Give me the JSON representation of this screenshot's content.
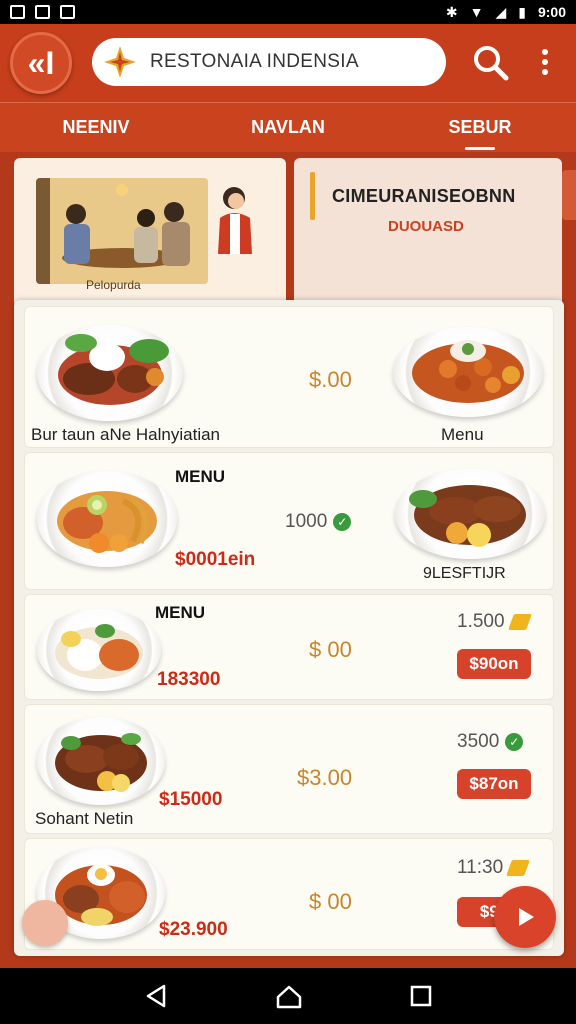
{
  "status": {
    "time": "9:00"
  },
  "header": {
    "back_label": "«I",
    "search_text": "RESTONAIA  INDENSIA"
  },
  "tabs": [
    {
      "label": "NEENIV",
      "active": false
    },
    {
      "label": "NAVLAN",
      "active": false
    },
    {
      "label": "SEBUR",
      "active": true
    }
  ],
  "promo": {
    "photo_caption": "Pelopurda",
    "title": "CIMEURANISEOBNN",
    "subtitle": "DUOUASD"
  },
  "rows": [
    {
      "left_name": "Bur taun aNe Halnyiatian",
      "price": "$.00",
      "right_label": "Menu"
    },
    {
      "menu_label": "MENU",
      "left_price": "$0001ein",
      "rating": "1000",
      "right_label": "9LESFTIJR"
    },
    {
      "menu_label": "MENU",
      "left_price": "183300",
      "price": "$ 00",
      "rating": "1.500",
      "badge": "$90on"
    },
    {
      "left_price": "$15000",
      "left_name": "Sohant Netin",
      "price": "$3.00",
      "rating": "3500",
      "badge": "$87on"
    },
    {
      "left_price": "$23.900",
      "price": "$ 00",
      "rating": "11:30",
      "badge": "$90"
    }
  ],
  "colors": {
    "primary": "#c63e1c",
    "price_gold": "#c6862b",
    "price_red": "#cc2c17",
    "badge": "#d6432a"
  }
}
